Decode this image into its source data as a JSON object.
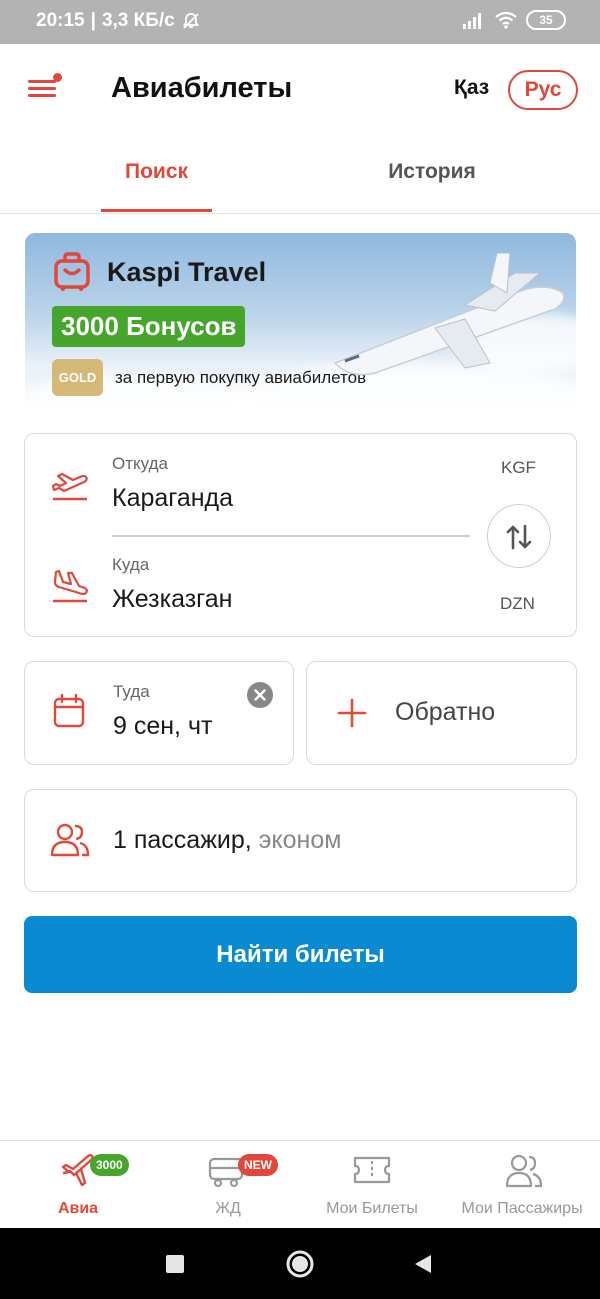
{
  "status_bar": {
    "time": "20:15",
    "net_speed": "3,3 КБ/с",
    "battery": "35"
  },
  "header": {
    "title": "Авиабилеты",
    "lang_kaz": "Қаз",
    "lang_rus": "Рус",
    "accent_color": "#e1473a"
  },
  "tabs": {
    "search": "Поиск",
    "history": "История",
    "active": "search"
  },
  "banner": {
    "brand": "Kaspi Travel",
    "bonus": "3000 Бонусов",
    "gold": "GOLD",
    "caption": "за первую покупку авиабилетов"
  },
  "route": {
    "from_label": "Откуда",
    "from_city": "Караганда",
    "from_code": "KGF",
    "to_label": "Куда",
    "to_city": "Жезказган",
    "to_code": "DZN"
  },
  "dates": {
    "to_label": "Туда",
    "to_value": "9 сен, чт",
    "back_label": "Обратно"
  },
  "passengers": {
    "count": "1 пассажир,",
    "class": " эконом"
  },
  "search_button": {
    "label": "Найти билеты",
    "color": "#0a8bd1"
  },
  "bottom_nav": {
    "items": [
      {
        "label": "Авиа",
        "icon": "plane-icon",
        "badge": "3000 ₸"
      },
      {
        "label": "ЖД",
        "icon": "train-icon",
        "badge": "NEW"
      },
      {
        "label": "Мои Билеты",
        "icon": "ticket-icon"
      },
      {
        "label": "Мои Пассажиры",
        "icon": "passengers-icon"
      }
    ],
    "active": 0
  }
}
